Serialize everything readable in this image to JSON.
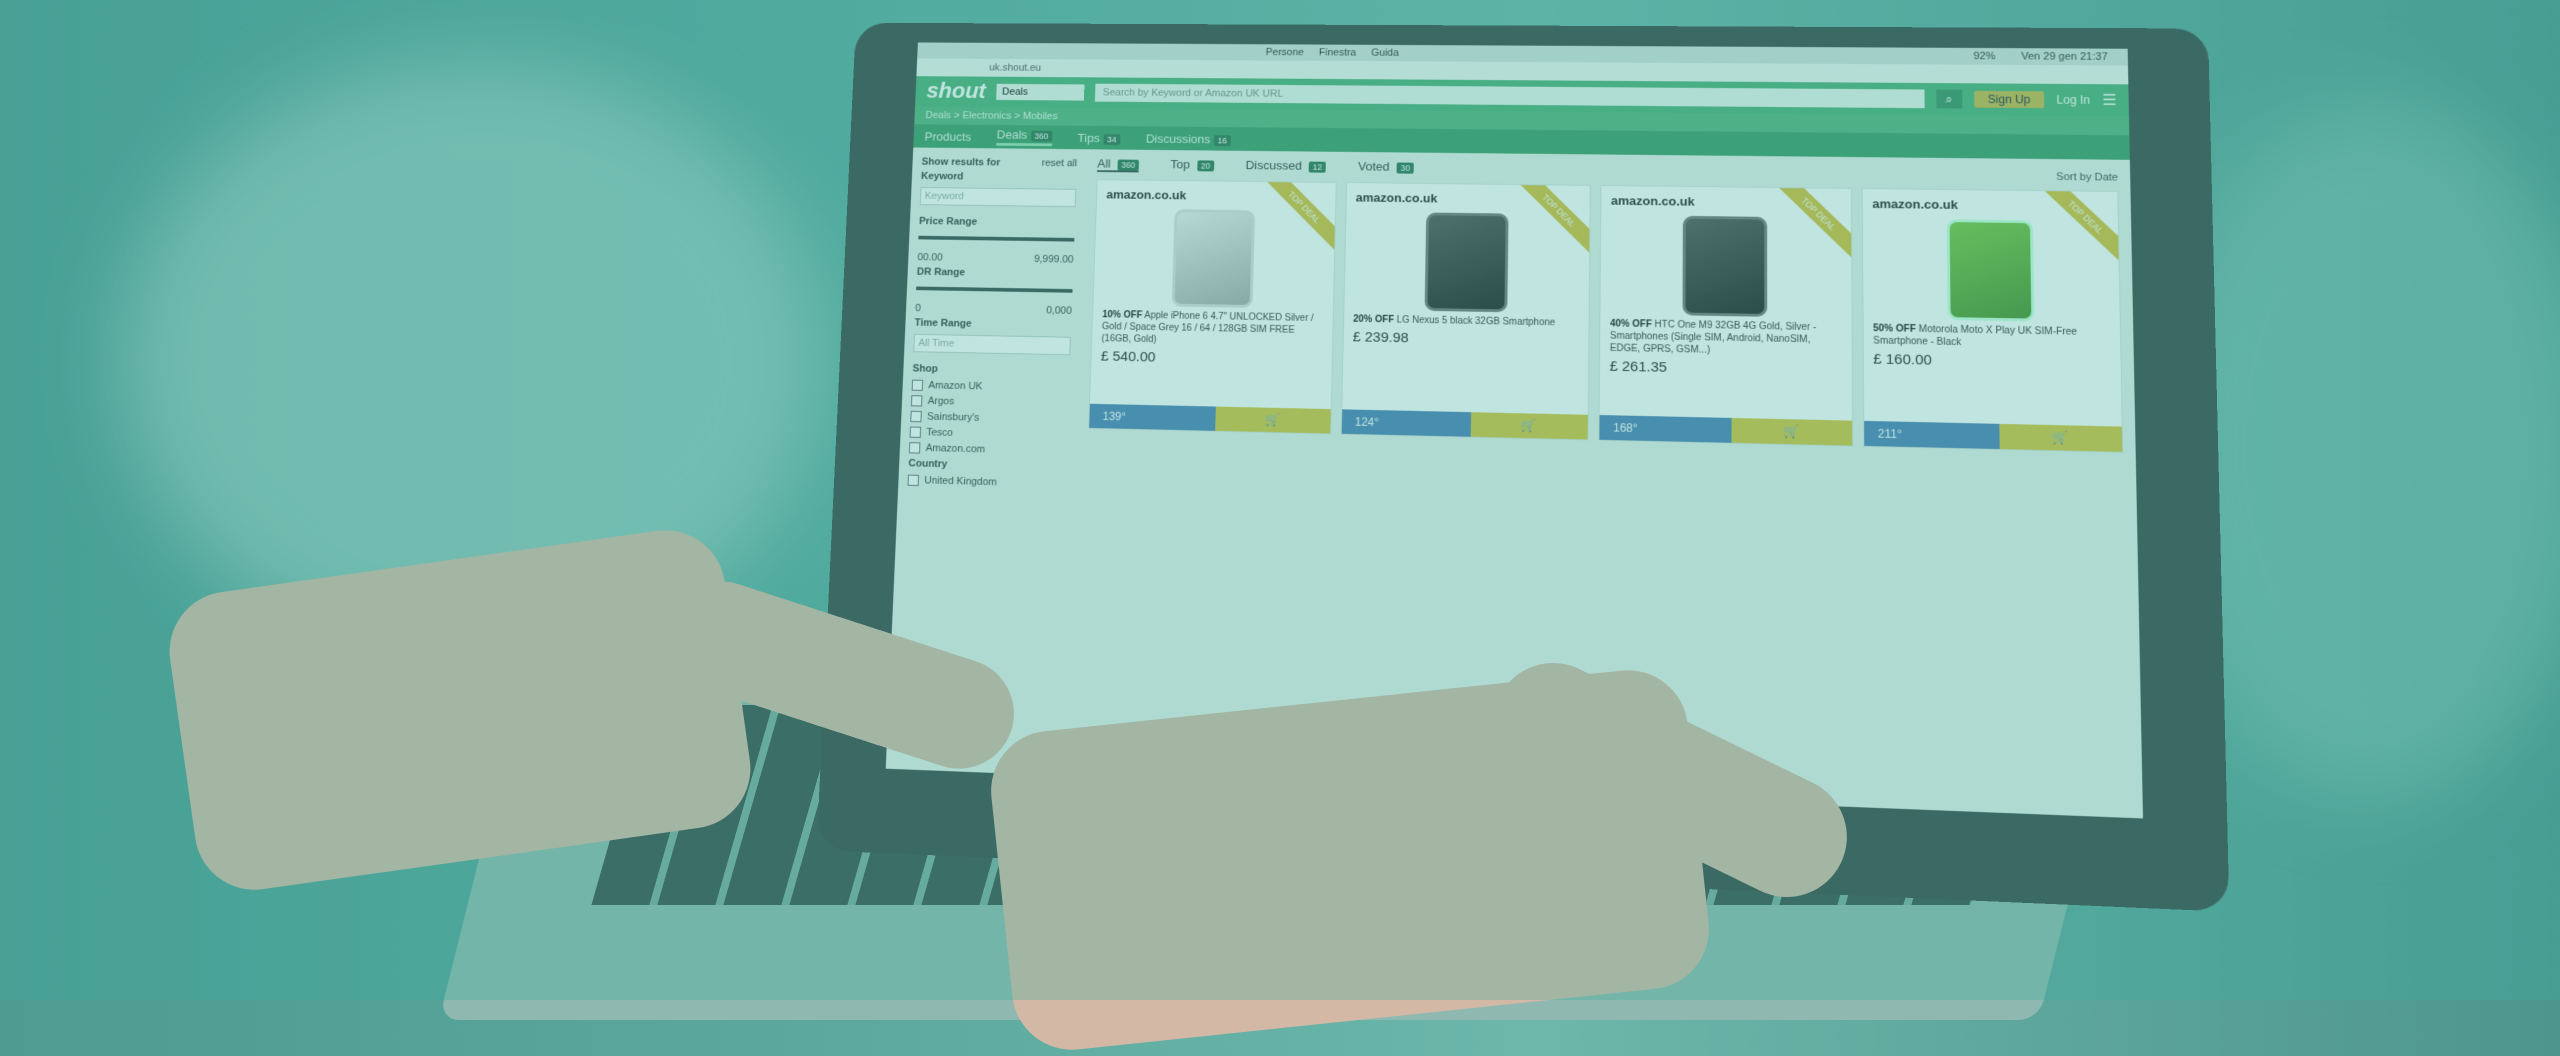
{
  "system": {
    "menu": [
      "Persone",
      "Finestra",
      "Guida"
    ],
    "clock": "Ven 29 gen 21:37",
    "battery": "92%"
  },
  "browser": {
    "url": "uk.shout.eu"
  },
  "site": {
    "logo": "shout",
    "dropdown": "Deals",
    "search_placeholder": "Search by Keyword or Amazon UK URL",
    "signup": "Sign Up",
    "login": "Log In",
    "breadcrumb": "Deals > Electronics > Mobiles",
    "tabs": [
      {
        "label": "Products",
        "count": ""
      },
      {
        "label": "Deals",
        "count": "360"
      },
      {
        "label": "Tips",
        "count": "34"
      },
      {
        "label": "Discussions",
        "count": "16"
      }
    ]
  },
  "sidebar": {
    "title": "Show results for",
    "reset": "reset all",
    "keyword_label": "Keyword",
    "keyword_placeholder": "Keyword",
    "price_label": "Price Range",
    "price_min": "00.00",
    "price_max": "9,999.00",
    "dr_label": "DR Range",
    "dr_min": "0",
    "dr_max": "0,000",
    "time_label": "Time Range",
    "time_value": "All Time",
    "shop_label": "Shop",
    "shops": [
      "Amazon UK",
      "Argos",
      "Sainsbury's",
      "Tesco",
      "Amazon.com"
    ],
    "country_label": "Country",
    "country": "United Kingdom"
  },
  "filter_tabs": [
    {
      "label": "All",
      "count": "360"
    },
    {
      "label": "Top",
      "count": "20"
    },
    {
      "label": "Discussed",
      "count": "12"
    },
    {
      "label": "Voted",
      "count": "30"
    }
  ],
  "sort": {
    "label": "Sort by",
    "value": "Date"
  },
  "products": [
    {
      "shop": "amazon.co.uk",
      "ribbon": "TOP DEAL",
      "discount": "10% OFF",
      "title": "Apple iPhone 6 4.7\" UNLOCKED Silver / Gold / Space Grey 16 / 64 / 128GB SIM FREE (16GB, Gold)",
      "price": "£ 540.00",
      "votes": "139°",
      "style": "silver"
    },
    {
      "shop": "amazon.co.uk",
      "ribbon": "TOP DEAL",
      "discount": "20% OFF",
      "title": "LG Nexus 5 black 32GB Smartphone",
      "price": "£ 239.98",
      "votes": "124°",
      "style": "dark"
    },
    {
      "shop": "amazon.co.uk",
      "ribbon": "TOP DEAL",
      "discount": "40% OFF",
      "title": "HTC One M9 32GB 4G Gold, Silver - Smartphones (Single SIM, Android, NanoSIM, EDGE, GPRS, GSM...)",
      "price": "£ 261.35",
      "votes": "168°",
      "style": "dark"
    },
    {
      "shop": "amazon.co.uk",
      "ribbon": "TOP DEAL",
      "discount": "50% OFF",
      "title": "Motorola Moto X Play UK SIM-Free Smartphone - Black",
      "price": "£ 160.00",
      "votes": "211°",
      "style": "green"
    }
  ]
}
